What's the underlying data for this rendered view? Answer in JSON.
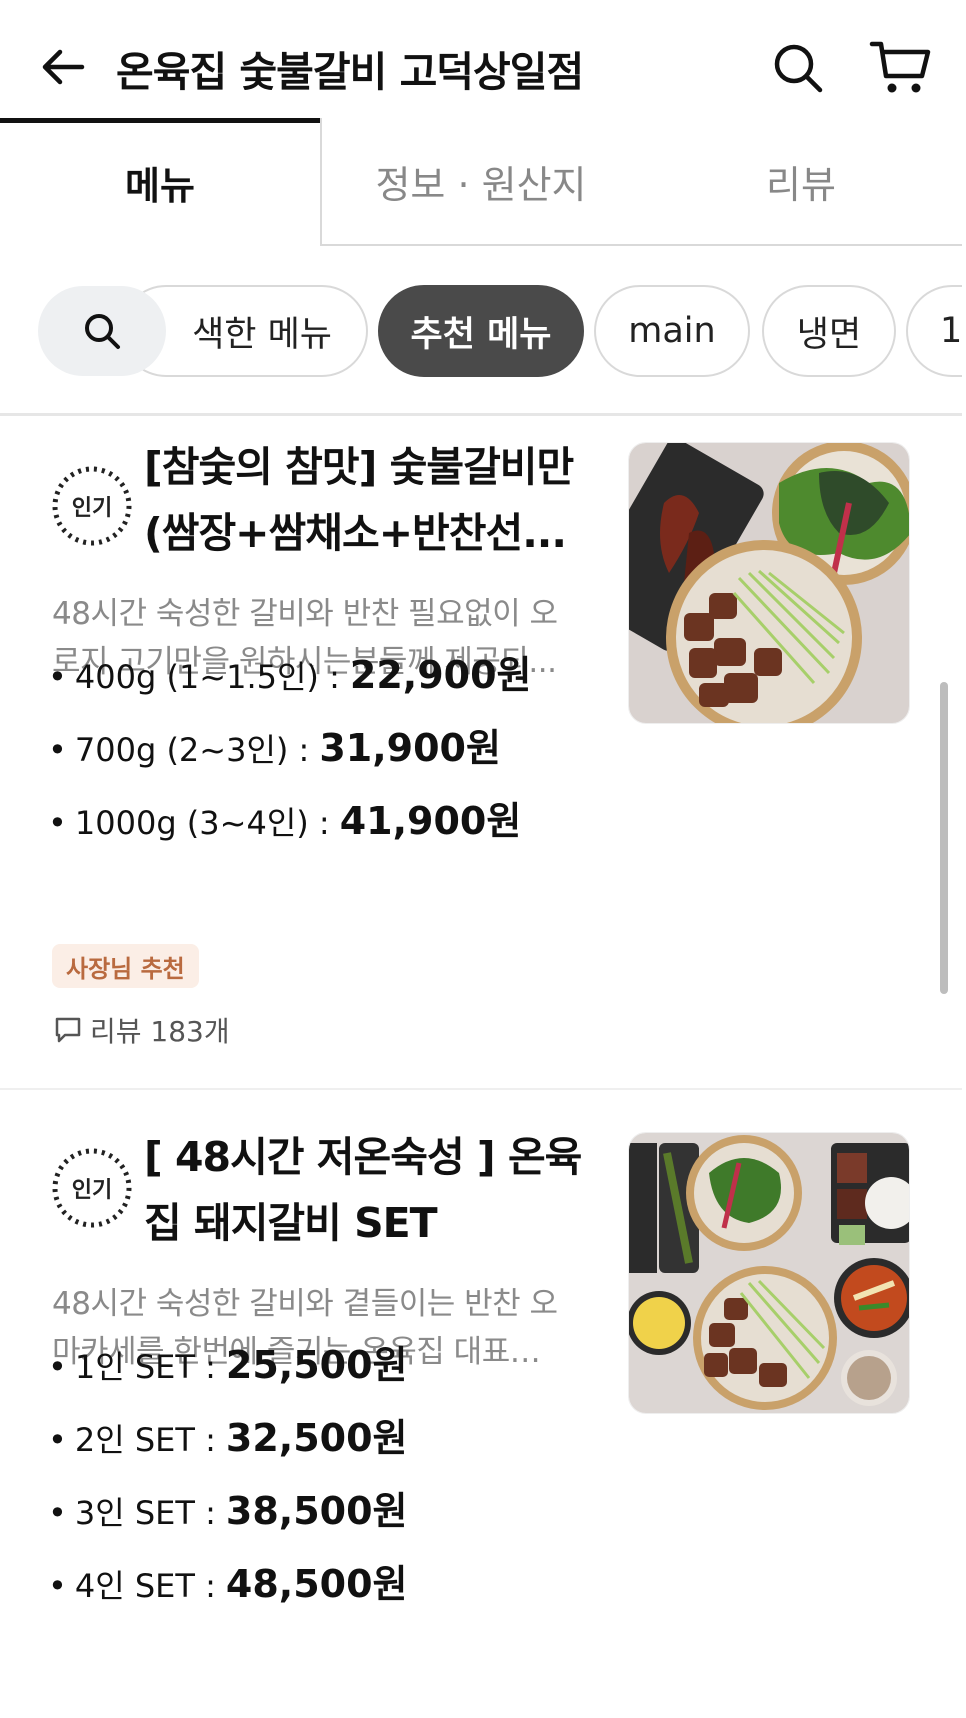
{
  "header": {
    "title": "온육집 숯불갈비 고덕상일점"
  },
  "tabs": [
    {
      "label": "메뉴",
      "active": true
    },
    {
      "label": "정보 · 원산지",
      "active": false
    },
    {
      "label": "리뷰",
      "active": false
    }
  ],
  "chips": [
    {
      "label": "검색한 메뉴",
      "visible_text": "색한 메뉴",
      "active": false
    },
    {
      "label": "추천 메뉴",
      "active": true
    },
    {
      "label": "main",
      "active": false
    },
    {
      "label": "냉면",
      "active": false
    },
    {
      "label": "1",
      "active": false
    }
  ],
  "badge_label": "인기",
  "items": [
    {
      "name_line1": "[참숯의 참맛] 숯불갈비만",
      "name_line2": "(쌈장+쌈채소+반찬선...",
      "desc_line1": "48시간 숙성한 갈비와 반찬 필요없이 오",
      "desc_line2": "로지 고기만을 원하시는분들께  제공되...",
      "options": [
        {
          "label": "400g (1~1.5인) :",
          "price": "22,900원"
        },
        {
          "label": "700g (2~3인) :",
          "price": "31,900원"
        },
        {
          "label": "1000g (3~4인) :",
          "price": "41,900원"
        }
      ],
      "recommend_badge": "사장님 추천",
      "review_text": "리뷰 183개"
    },
    {
      "name_line1": "[ 48시간 저온숙성 ] 온육",
      "name_line2": "집 돼지갈비 SET",
      "desc_line1": "48시간 숙성한 갈비와 곁들이는 반찬 오",
      "desc_line2": "마카세를 한번에 즐기는 온육집 대표…",
      "options": [
        {
          "label": "1인 SET :",
          "price": "25,500원"
        },
        {
          "label": "2인 SET :",
          "price": "32,500원"
        },
        {
          "label": "3인 SET :",
          "price": "38,500원"
        },
        {
          "label": "4인 SET :",
          "price": "48,500원"
        }
      ]
    }
  ],
  "colors": {
    "active_chip": "#4a4a4a",
    "recommend_bg": "#fbeee6",
    "recommend_text": "#b96a3f",
    "muted_text": "#8a8a8a"
  },
  "icons": [
    "back-arrow-icon",
    "search-icon",
    "cart-icon",
    "popular-badge-icon",
    "review-bubble-icon"
  ]
}
